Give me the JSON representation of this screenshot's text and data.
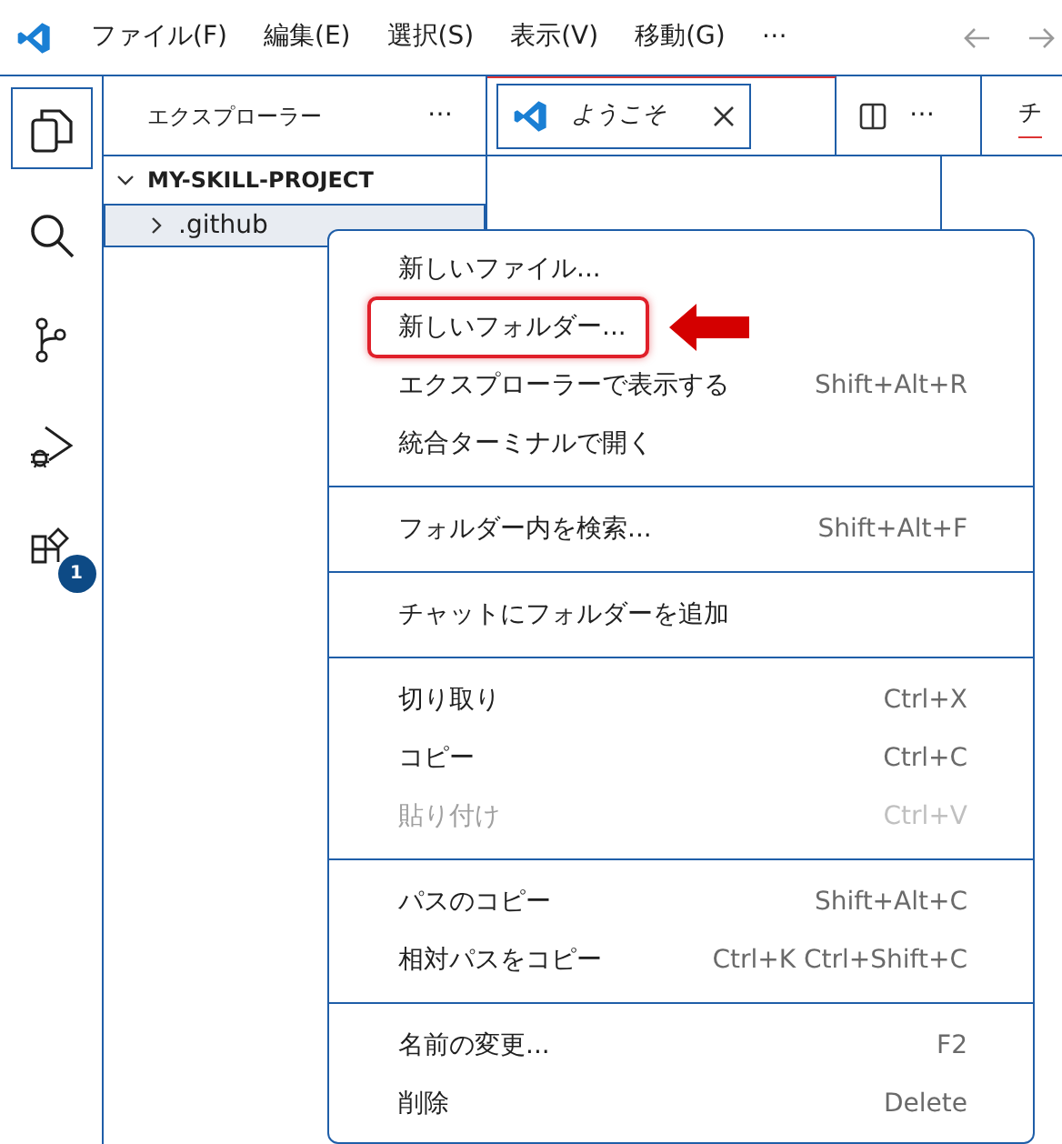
{
  "menu_bar": [
    "ファイル(F)",
    "編集(E)",
    "選択(S)",
    "表示(V)",
    "移動(G)",
    "⋯"
  ],
  "activity_bar": [
    {
      "kind": "explorer",
      "selected": true
    },
    {
      "kind": "search",
      "selected": false
    },
    {
      "kind": "source-control",
      "selected": false
    },
    {
      "kind": "run-debug",
      "selected": false
    },
    {
      "kind": "extensions",
      "selected": false,
      "badge": "1"
    }
  ],
  "sidebar": {
    "title": "エクスプローラー",
    "more": "⋯",
    "project": "MY-SKILL-PROJECT",
    "items": [
      {
        "label": ".github",
        "selected": true,
        "expanded": false
      }
    ]
  },
  "editor": {
    "tabs": [
      {
        "label": "ようこそ",
        "selected": true
      }
    ],
    "more": "⋯",
    "right_tab": "チ"
  },
  "context_menu": [
    [
      {
        "label": "新しいファイル...",
        "highlighted": false
      },
      {
        "label": "新しいフォルダー...",
        "highlighted": true
      },
      {
        "label": "エクスプローラーで表示する",
        "shortcut": "Shift+Alt+R",
        "highlighted": false
      },
      {
        "label": "統合ターミナルで開く",
        "highlighted": false
      }
    ],
    [
      {
        "label": "フォルダー内を検索...",
        "shortcut": "Shift+Alt+F",
        "highlighted": false
      }
    ],
    [
      {
        "label": "チャットにフォルダーを追加",
        "highlighted": false
      }
    ],
    [
      {
        "label": "切り取り",
        "shortcut": "Ctrl+X",
        "disabled": false,
        "highlighted": false
      },
      {
        "label": "コピー",
        "shortcut": "Ctrl+C",
        "disabled": false,
        "highlighted": false
      },
      {
        "label": "貼り付け",
        "shortcut": "Ctrl+V",
        "disabled": true,
        "highlighted": false
      }
    ],
    [
      {
        "label": "パスのコピー",
        "shortcut": "Shift+Alt+C",
        "highlighted": false
      },
      {
        "label": "相対パスをコピー",
        "shortcut": "Ctrl+K Ctrl+Shift+C",
        "highlighted": false
      }
    ],
    [
      {
        "label": "名前の変更...",
        "shortcut": "F2",
        "highlighted": false
      },
      {
        "label": "削除",
        "shortcut": "Delete",
        "highlighted": false
      }
    ]
  ]
}
